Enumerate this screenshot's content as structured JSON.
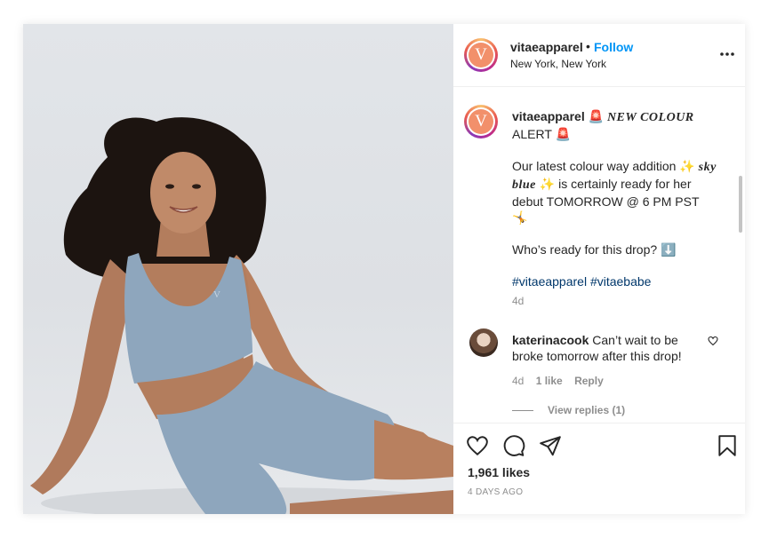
{
  "post": {
    "username": "vitaeapparel",
    "follow_label": "Follow",
    "separator": "•",
    "location": "New York, New York",
    "avatar_letter": "V",
    "logo_mark": "V"
  },
  "caption": {
    "username": "vitaeapparel",
    "siren": "🚨",
    "headline": "NEW COLOUR",
    "alert": "ALERT",
    "line2_pre": "Our latest colour way addition",
    "sparkle": "✨",
    "colour_name": "sky blue",
    "line2_post": "is certainly ready for her debut TOMORROW @ 6 PM PST",
    "emoji_end": "🤸",
    "question": "Who’s ready for this drop?",
    "arrow": "⬇️",
    "hashtags": "#vitaeapparel #vitaebabe",
    "time": "4d"
  },
  "comment": {
    "username": "katerinacook",
    "text": "Can’t wait to be broke tomorrow after this drop!",
    "time": "4d",
    "likes": "1 like",
    "reply_label": "Reply",
    "view_replies": "View replies (1)"
  },
  "footer": {
    "likes": "1,961 likes",
    "time_ago": "4 DAYS AGO"
  },
  "icons": {
    "more": "more-options-icon",
    "like": "heart-icon",
    "comment": "comment-icon",
    "share": "share-icon",
    "save": "bookmark-icon"
  },
  "colors": {
    "follow": "#0095f6",
    "outfit": "#8ea6bd",
    "avatar": "#f2906b"
  }
}
